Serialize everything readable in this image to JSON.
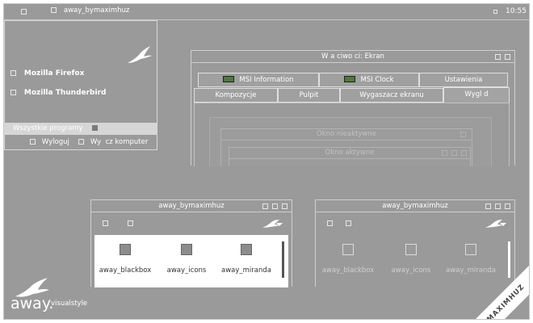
{
  "taskbar": {
    "app_label": "away_bymaximhuz",
    "clock": "10:55"
  },
  "start_menu": {
    "items": [
      "Mozilla Firefox",
      "Mozilla Thunderbird"
    ],
    "all_programs": "Wszystkie programy",
    "logoff": "Wyloguj",
    "shutdown": "Wy  cz komputer"
  },
  "display_props": {
    "title": "W a ciwo ci: Ekran",
    "tabs_row1": [
      "MSI Information",
      "MSI Clock",
      "Ustawienia"
    ],
    "tabs_row2": [
      "Kompozycje",
      "Pulpit",
      "Wygaszacz ekranu",
      "Wygl d"
    ],
    "preview_inactive": "Okno nieaktywne",
    "preview_active": "Okno aktywne"
  },
  "explorer_left": {
    "title": "away_bymaximhuz",
    "items": [
      "away_blackbox",
      "away_icons",
      "away_miranda"
    ]
  },
  "explorer_right": {
    "title": "away_bymaximhuz",
    "items": [
      "away_blackbox",
      "away_icons",
      "away_miranda"
    ]
  },
  "logo": {
    "word": "away.",
    "sub": "visualstyle"
  },
  "ribbon": {
    "text": "MAXIMHUZ"
  },
  "colors": {
    "desktop": "#9a9a9a",
    "white_panel": "#ffffff",
    "ribbon": "#ffffff"
  }
}
